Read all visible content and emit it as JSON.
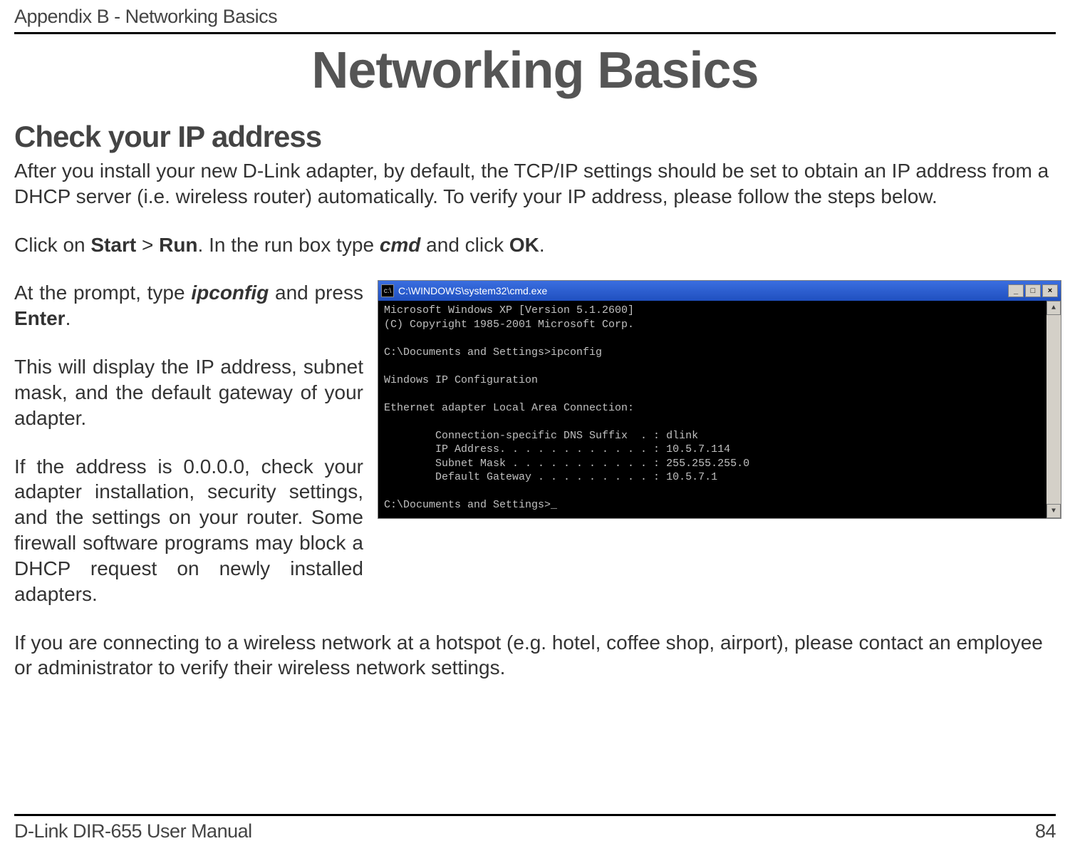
{
  "header": {
    "appendix_label": "Appendix B - Networking Basics"
  },
  "title": "Networking Basics",
  "section_heading": "Check your IP address",
  "intro": "After you install your new D-Link adapter, by default, the TCP/IP settings should be set to obtain an IP address from a DHCP server (i.e. wireless router) automatically. To verify your IP address, please follow the steps below.",
  "step1_pre": "Click on ",
  "step1_start": "Start",
  "step1_gt": " > ",
  "step1_run": "Run",
  "step1_mid": ". In the run box type ",
  "step1_cmd": "cmd",
  "step1_post": " and click ",
  "step1_ok": "OK",
  "step1_end": ".",
  "left": {
    "prompt_pre": "At the prompt, type ",
    "prompt_cmd": "ipconfig",
    "prompt_mid": " and press ",
    "prompt_enter": "Enter",
    "prompt_end": ".",
    "display_text": "This will display the IP address, subnet mask, and the default gateway of your adapter.",
    "zero_text": "If the address is 0.0.0.0, check your adapter installation, security settings, and the settings on your router. Some firewall software programs may block a DHCP request on newly installed adapters."
  },
  "cmd_window": {
    "title": "C:\\WINDOWS\\system32\\cmd.exe",
    "lines": [
      "Microsoft Windows XP [Version 5.1.2600]",
      "(C) Copyright 1985-2001 Microsoft Corp.",
      "",
      "C:\\Documents and Settings>ipconfig",
      "",
      "Windows IP Configuration",
      "",
      "Ethernet adapter Local Area Connection:",
      "",
      "        Connection-specific DNS Suffix  . : dlink",
      "        IP Address. . . . . . . . . . . . : 10.5.7.114",
      "        Subnet Mask . . . . . . . . . . . : 255.255.255.0",
      "        Default Gateway . . . . . . . . . : 10.5.7.1",
      "",
      "C:\\Documents and Settings>_"
    ]
  },
  "hotspot": "If you are connecting to a wireless network at a hotspot (e.g. hotel, coffee shop, airport), please contact an employee or administrator to verify their wireless network settings.",
  "footer": {
    "manual": "D-Link DIR-655 User Manual",
    "page": "84"
  }
}
